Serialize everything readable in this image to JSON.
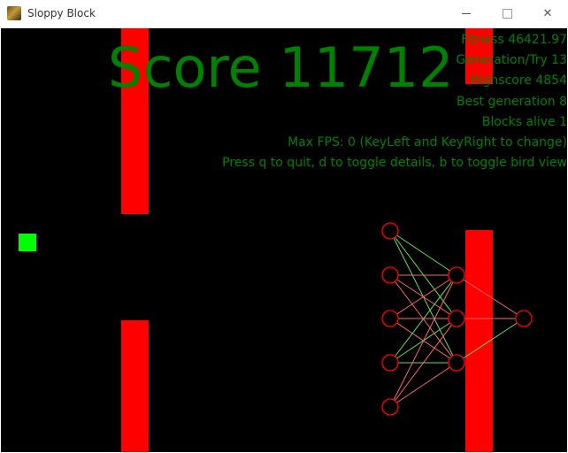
{
  "window": {
    "title": "Sloppy Block",
    "minimize_icon": "minimize-icon",
    "maximize_icon": "maximize-icon",
    "close_icon": "close-icon"
  },
  "game": {
    "background_color": "#000000",
    "pipe_color": "#ff0000",
    "bird_color": "#00ff00",
    "text_color": "#008000",
    "score_label": "Score 11712",
    "stats": {
      "fitness": "Fitness 46421.97",
      "generation": "Generation/Try 13",
      "highscore": "Highscore 4854",
      "best_generation": "Best generation 8",
      "blocks_alive": "Blocks alive 1",
      "max_fps": "Max FPS: 0 (KeyLeft and KeyRight to change)",
      "help": "Press q to quit, d to toggle details, b to toggle bird view"
    },
    "network": {
      "layers": [
        5,
        3,
        1
      ],
      "node_color": "#ff0000",
      "positive_weight_color": "#ff6666",
      "negative_weight_color": "#66dd55"
    }
  }
}
